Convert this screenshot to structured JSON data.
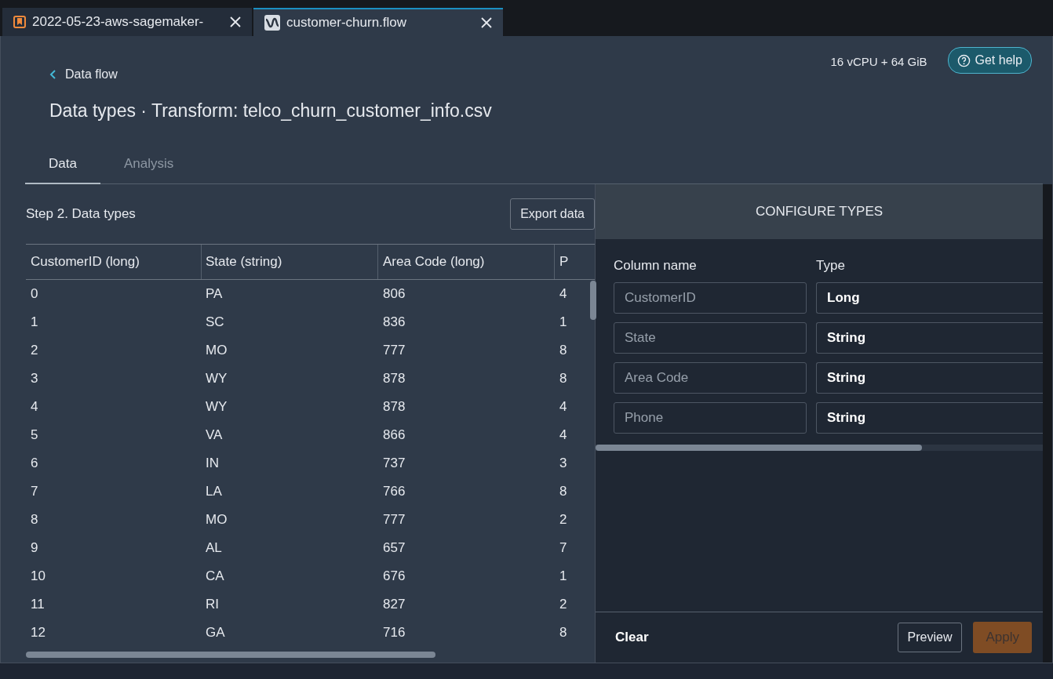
{
  "tabs": [
    {
      "label": "2022-05-23-aws-sagemaker-",
      "selected": false
    },
    {
      "label": "customer-churn.flow",
      "selected": true
    }
  ],
  "resources": "16 vCPU + 64 GiB",
  "help_button": "Get help",
  "breadcrumb": "Data flow",
  "title": "Data types · Transform: telco_churn_customer_info.csv",
  "view_tabs": [
    {
      "label": "Data",
      "selected": true
    },
    {
      "label": "Analysis",
      "selected": false
    }
  ],
  "step_title": "Step 2. Data types",
  "export_button": "Export data",
  "table": {
    "columns": [
      "CustomerID (long)",
      "State (string)",
      "Area Code (long)",
      "P"
    ],
    "rows": [
      [
        "0",
        "PA",
        "806",
        "4"
      ],
      [
        "1",
        "SC",
        "836",
        "1"
      ],
      [
        "2",
        "MO",
        "777",
        "8"
      ],
      [
        "3",
        "WY",
        "878",
        "8"
      ],
      [
        "4",
        "WY",
        "878",
        "4"
      ],
      [
        "5",
        "VA",
        "866",
        "4"
      ],
      [
        "6",
        "IN",
        "737",
        "3"
      ],
      [
        "7",
        "LA",
        "766",
        "8"
      ],
      [
        "8",
        "MO",
        "777",
        "2"
      ],
      [
        "9",
        "AL",
        "657",
        "7"
      ],
      [
        "10",
        "CA",
        "676",
        "1"
      ],
      [
        "11",
        "RI",
        "827",
        "2"
      ],
      [
        "12",
        "GA",
        "716",
        "8"
      ]
    ]
  },
  "configure": {
    "title": "CONFIGURE TYPES",
    "column_header": "Column name",
    "type_header": "Type",
    "rows": [
      {
        "column": "CustomerID",
        "type": "Long"
      },
      {
        "column": "State",
        "type": "String"
      },
      {
        "column": "Area Code",
        "type": "String"
      },
      {
        "column": "Phone",
        "type": "String"
      }
    ]
  },
  "clear_button": "Clear",
  "preview_button": "Preview",
  "apply_button": {
    "label": "Apply",
    "disabled": true
  }
}
